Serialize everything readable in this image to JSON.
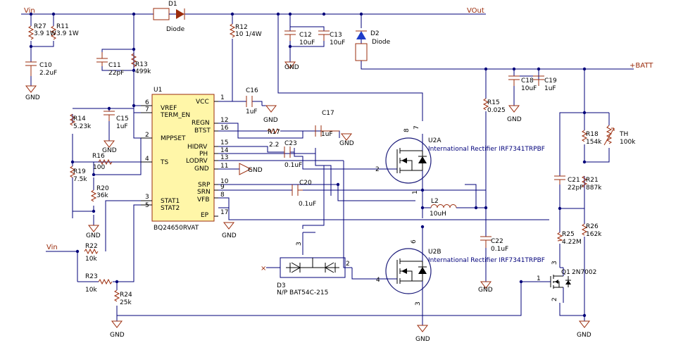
{
  "nets": {
    "vin": "Vin",
    "vout": "VOut",
    "batt": "+BATT",
    "gnd": "GND"
  },
  "u1": {
    "ref": "U1",
    "part": "BQ24650RVAT",
    "left_pins": [
      {
        "num": "6",
        "name": "VREF"
      },
      {
        "num": "7",
        "name": "TERM_EN"
      },
      {
        "num": "2",
        "name": "MPPSET"
      },
      {
        "num": "4",
        "name": "TS"
      },
      {
        "num": "3",
        "name": "STAT1"
      },
      {
        "num": "5",
        "name": "STAT2"
      }
    ],
    "right_pins": [
      {
        "num": "1",
        "name": "VCC"
      },
      {
        "num": "12",
        "name": "REGN"
      },
      {
        "num": "16",
        "name": "BTST"
      },
      {
        "num": "15",
        "name": "HIDRV"
      },
      {
        "num": "14",
        "name": "PH"
      },
      {
        "num": "13",
        "name": "LODRV"
      },
      {
        "num": "11",
        "name": "GND"
      },
      {
        "num": "10",
        "name": "SRP"
      },
      {
        "num": "9",
        "name": "SRN"
      },
      {
        "num": "8",
        "name": "VFB"
      },
      {
        "num": "17",
        "name": "EP"
      }
    ]
  },
  "components": {
    "d1": {
      "ref": "D1",
      "value": "Diode"
    },
    "d2": {
      "ref": "D2",
      "value": "Diode"
    },
    "d3": {
      "ref": "D3",
      "value": "N/P  BAT54C-215"
    },
    "r27": {
      "ref": "R27",
      "value": "3.9 1W"
    },
    "r11": {
      "ref": "R11",
      "value": "3.9 1W"
    },
    "c10": {
      "ref": "C10",
      "value": "2.2uF"
    },
    "c11": {
      "ref": "C11",
      "value": "22pF"
    },
    "r13": {
      "ref": "R13",
      "value": "499k"
    },
    "r12": {
      "ref": "R12",
      "value": "10 1/4W"
    },
    "c12": {
      "ref": "C12",
      "value": "10uF"
    },
    "c13": {
      "ref": "C13",
      "value": "10uF"
    },
    "c16": {
      "ref": "C16",
      "value": "1uF"
    },
    "c17": {
      "ref": "C17",
      "value": "1uF"
    },
    "r17": {
      "ref": "R17",
      "value": "2.2"
    },
    "c23": {
      "ref": "C23",
      "value": "0.1uF"
    },
    "c20": {
      "ref": "C20",
      "value": "0.1uF"
    },
    "r14": {
      "ref": "R14",
      "value": "5.23k"
    },
    "c15": {
      "ref": "C15",
      "value": "1uF"
    },
    "r16": {
      "ref": "R16",
      "value": "100"
    },
    "r19": {
      "ref": "R19",
      "value": "7.5k"
    },
    "r20": {
      "ref": "R20",
      "value": "36k"
    },
    "r22": {
      "ref": "R22",
      "value": "10k"
    },
    "r23": {
      "ref": "R23",
      "value": "10k"
    },
    "r24": {
      "ref": "R24",
      "value": "25k"
    },
    "u2a": {
      "ref": "U2A",
      "value": "International Rectifier IRF7341TRPBF"
    },
    "u2b": {
      "ref": "U2B",
      "value": "International Rectifier IRF7341TRPBF"
    },
    "l2": {
      "ref": "L2",
      "value": "10uH"
    },
    "r15": {
      "ref": "R15",
      "value": "0.025"
    },
    "c22": {
      "ref": "C22",
      "value": "0.1uF"
    },
    "c18": {
      "ref": "C18",
      "value": "10uF"
    },
    "c19": {
      "ref": "C19",
      "value": "1uF"
    },
    "r18": {
      "ref": "R18",
      "value": "154k"
    },
    "th": {
      "ref": "TH",
      "value": "100k"
    },
    "c21": {
      "ref": "C21",
      "value": "22pF"
    },
    "r21": {
      "ref": "R21",
      "value": "887k"
    },
    "r26": {
      "ref": "R26",
      "value": "162k"
    },
    "r25": {
      "ref": "R25",
      "value": "4.22M"
    },
    "q1": {
      "ref": "Q1",
      "value": "2N7002"
    }
  },
  "pin_nums": {
    "q_top8": "8",
    "q_top7": "7",
    "q_top1": "1",
    "q_bot6": "6",
    "q_bot3": "3",
    "u2a_gate": "2",
    "u2b_gate": "4",
    "d3_a": "3",
    "d3_b": "2",
    "q1_g": "1",
    "q1_s": "2",
    "q1_d": "3"
  },
  "colors": {
    "wire": "#00007a",
    "component": "#9b2c0c",
    "ic_fill": "#fff6a8",
    "net_label": "#9b2c0c"
  }
}
